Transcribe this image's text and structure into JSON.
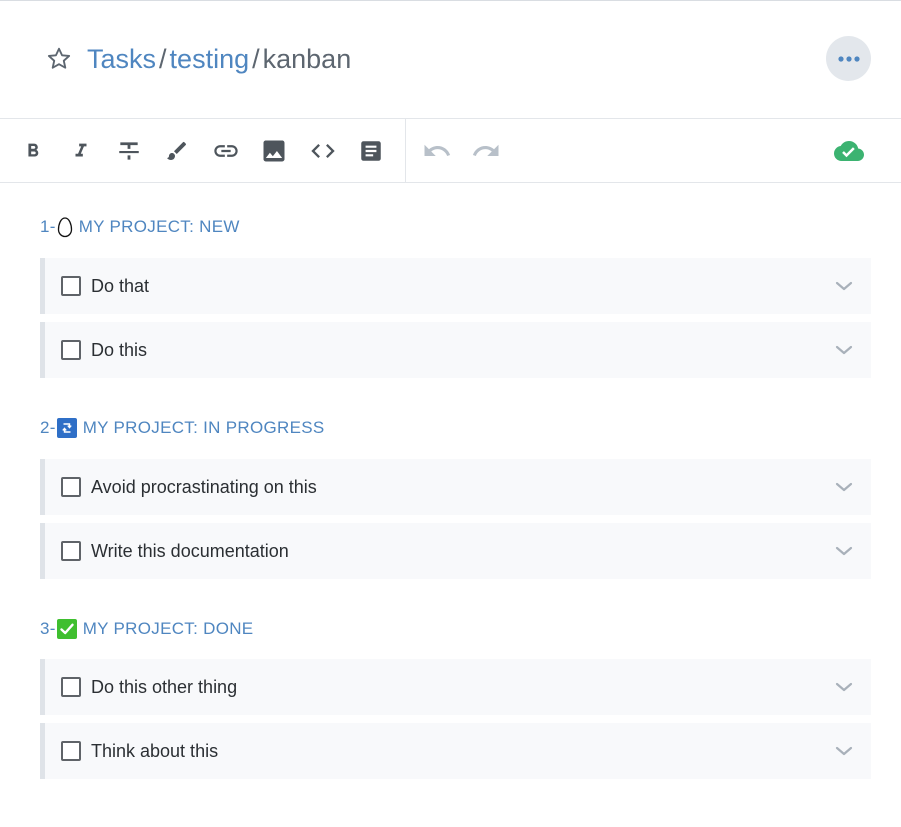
{
  "header": {
    "breadcrumb": [
      {
        "label": "Tasks",
        "kind": "link"
      },
      {
        "label": "testing",
        "kind": "link"
      },
      {
        "label": "kanban",
        "kind": "current"
      }
    ],
    "separator": "/",
    "icons": {
      "favorite": "star-outline-icon",
      "more": "more-horizontal-icon"
    }
  },
  "toolbar": {
    "icons": [
      "bold-icon",
      "italic-icon",
      "strikethrough-icon",
      "brush-icon",
      "link-icon",
      "image-icon",
      "code-icon",
      "note-icon",
      "undo-icon",
      "redo-icon",
      "cloud-check-icon"
    ]
  },
  "sections": [
    {
      "number": "1-",
      "emoji": "egg-icon",
      "title": "MY PROJECT: NEW",
      "tasks": [
        {
          "label": "Do that",
          "checked": false
        },
        {
          "label": "Do this",
          "checked": false
        }
      ]
    },
    {
      "number": "2-",
      "emoji": "repeat-icon",
      "title": "MY PROJECT: IN PROGRESS",
      "tasks": [
        {
          "label": "Avoid procrastinating on this",
          "checked": false
        },
        {
          "label": "Write this documentation",
          "checked": false
        }
      ]
    },
    {
      "number": "3-",
      "emoji": "check-mark-button-icon",
      "title": "MY PROJECT: DONE",
      "tasks": [
        {
          "label": "Do this other thing",
          "checked": false
        },
        {
          "label": "Think about this",
          "checked": false
        }
      ]
    }
  ],
  "colors": {
    "link": "#4f86c0",
    "text_muted": "#5d6670",
    "icon": "#4e555c",
    "icon_disabled": "#b8c0c9",
    "sync_ok": "#3cb371",
    "row_bg": "#f8f9fb",
    "row_border": "#dfe3e8"
  }
}
